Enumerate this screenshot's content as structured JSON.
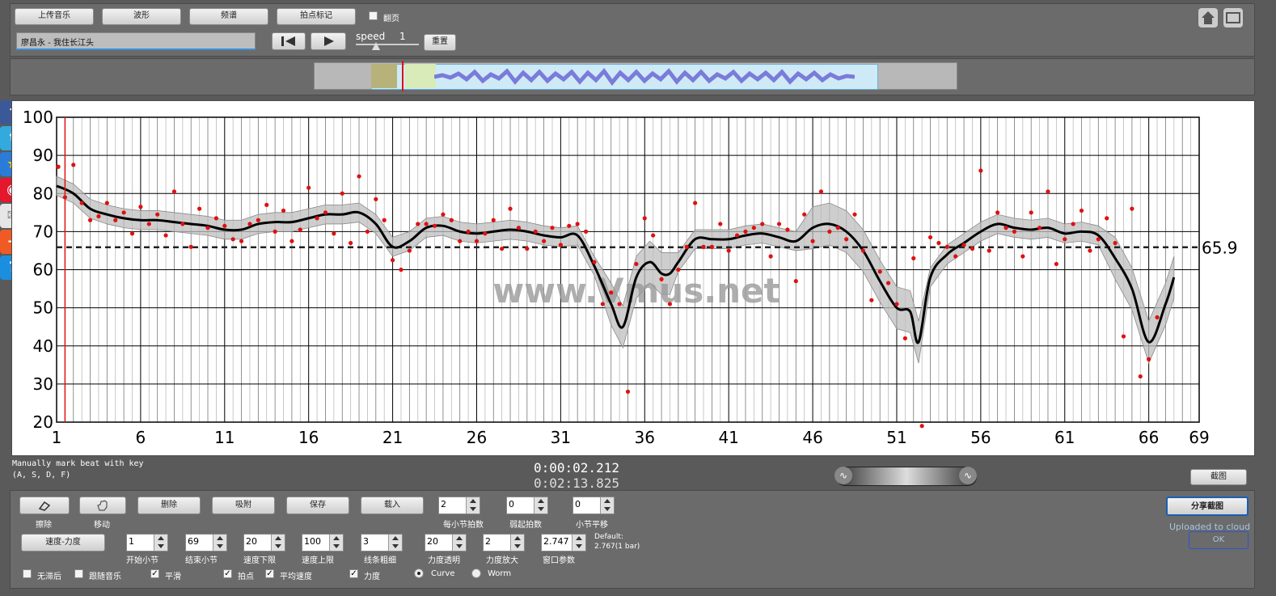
{
  "toolbar": {
    "upload": "上传音乐",
    "waveform": "波形",
    "spectrum": "频谱",
    "beat_mark": "拍点标记",
    "flip_label": "翻页"
  },
  "track": {
    "title": "廖昌永 - 我住长江头"
  },
  "speed": {
    "label": "speed",
    "value": "1",
    "reset": "重置"
  },
  "status": {
    "hint_line1": "Manually mark beat with key",
    "hint_line2": "(A, S, D, F)",
    "time_current": "0:00:02.212",
    "time_total": "0:02:13.825",
    "screenshot": "截图",
    "share": "分享截图",
    "uploaded": "Uploaded to cloud",
    "ok": "OK"
  },
  "controls": {
    "erase": "擦除",
    "move": "移动",
    "delete": "删除",
    "snap": "吸附",
    "save": "保存",
    "load": "载入",
    "beats_per_bar": {
      "value": "2",
      "label": "每小节拍数"
    },
    "weak_beats": {
      "value": "0",
      "label": "弱起拍数"
    },
    "bar_shift": {
      "value": "0",
      "label": "小节平移"
    },
    "mode_button": "速度-力度",
    "start_bar": {
      "value": "1",
      "label": "开始小节"
    },
    "end_bar": {
      "value": "69",
      "label": "结束小节"
    },
    "tempo_min": {
      "value": "20",
      "label": "速度下限"
    },
    "tempo_max": {
      "value": "100",
      "label": "速度上限"
    },
    "line_width": {
      "value": "3",
      "label": "线条粗细"
    },
    "force_alpha": {
      "value": "20",
      "label": "力度透明"
    },
    "force_scale": {
      "value": "2",
      "label": "力度放大"
    },
    "window": {
      "value": "2.747",
      "label": "窗口参数"
    },
    "default_line1": "Default:",
    "default_line2": "2.767(1 bar)",
    "checks": {
      "no_lag": "无滞后",
      "follow": "跟随音乐",
      "smooth": "平滑",
      "beats": "拍点",
      "avg": "平均速度",
      "force": "力度",
      "curve": "Curve",
      "worm": "Worm"
    }
  },
  "watermark": "www.Vmus.net",
  "chart_data": {
    "type": "line",
    "xlim": [
      1,
      69
    ],
    "ylim": [
      20,
      100
    ],
    "x_ticks": [
      1,
      6,
      11,
      16,
      21,
      26,
      31,
      36,
      41,
      46,
      51,
      56,
      61,
      66,
      69
    ],
    "y_ticks": [
      20,
      30,
      40,
      50,
      60,
      70,
      80,
      90,
      100
    ],
    "avg_label": "65.9",
    "avg_value": 65.9,
    "playhead_x": 1.5,
    "smooth": [
      [
        1,
        82
      ],
      [
        2,
        80
      ],
      [
        3,
        76
      ],
      [
        4,
        74.5
      ],
      [
        5,
        73.5
      ],
      [
        6,
        73
      ],
      [
        7,
        73
      ],
      [
        8,
        72.5
      ],
      [
        9,
        72
      ],
      [
        10,
        71.5
      ],
      [
        11,
        70.5
      ],
      [
        12,
        70.5
      ],
      [
        13,
        72
      ],
      [
        14,
        72.5
      ],
      [
        15,
        72.5
      ],
      [
        16,
        73.5
      ],
      [
        17,
        74.5
      ],
      [
        18,
        74.5
      ],
      [
        19,
        75
      ],
      [
        20,
        72
      ],
      [
        21,
        66
      ],
      [
        22,
        67.5
      ],
      [
        23,
        71
      ],
      [
        24,
        71.5
      ],
      [
        25,
        70
      ],
      [
        26,
        69.5
      ],
      [
        27,
        70
      ],
      [
        28,
        70.5
      ],
      [
        29,
        70
      ],
      [
        30,
        69
      ],
      [
        31,
        68.5
      ],
      [
        32,
        69
      ],
      [
        33,
        61
      ],
      [
        34,
        51
      ],
      [
        34.7,
        45
      ],
      [
        35.5,
        58
      ],
      [
        36.3,
        62
      ],
      [
        37,
        59
      ],
      [
        37.5,
        59
      ],
      [
        38,
        62
      ],
      [
        39,
        68
      ],
      [
        40,
        68
      ],
      [
        41,
        68
      ],
      [
        42,
        69
      ],
      [
        43,
        69.5
      ],
      [
        44,
        68.5
      ],
      [
        45,
        67.5
      ],
      [
        46,
        71
      ],
      [
        47,
        72
      ],
      [
        48,
        70
      ],
      [
        49,
        65
      ],
      [
        50,
        57
      ],
      [
        51,
        50
      ],
      [
        51.8,
        49
      ],
      [
        52.3,
        41
      ],
      [
        53,
        58
      ],
      [
        54,
        64
      ],
      [
        55,
        67
      ],
      [
        56,
        70
      ],
      [
        57,
        72
      ],
      [
        58,
        71
      ],
      [
        59,
        70.5
      ],
      [
        60,
        71
      ],
      [
        61,
        69.5
      ],
      [
        62,
        70
      ],
      [
        63,
        69
      ],
      [
        64,
        63
      ],
      [
        65,
        55
      ],
      [
        66,
        41
      ],
      [
        67,
        51
      ],
      [
        67.5,
        58
      ]
    ],
    "beats": [
      [
        1.1,
        87
      ],
      [
        1.5,
        79
      ],
      [
        2,
        87.5
      ],
      [
        2.5,
        77.5
      ],
      [
        3,
        73
      ],
      [
        3.5,
        74
      ],
      [
        4,
        77.5
      ],
      [
        4.5,
        73
      ],
      [
        5,
        75
      ],
      [
        5.5,
        69.5
      ],
      [
        6,
        76.5
      ],
      [
        6.5,
        72
      ],
      [
        7,
        74.5
      ],
      [
        7.5,
        69
      ],
      [
        8,
        80.5
      ],
      [
        8.5,
        72
      ],
      [
        9,
        66
      ],
      [
        9.5,
        76
      ],
      [
        10,
        71
      ],
      [
        10.5,
        73.5
      ],
      [
        11,
        71.5
      ],
      [
        11.5,
        68
      ],
      [
        12,
        67.5
      ],
      [
        12.5,
        72
      ],
      [
        13,
        73
      ],
      [
        13.5,
        77
      ],
      [
        14,
        70
      ],
      [
        14.5,
        75.5
      ],
      [
        15,
        67.5
      ],
      [
        15.5,
        70.5
      ],
      [
        16,
        81.5
      ],
      [
        16.5,
        73.5
      ],
      [
        17,
        75
      ],
      [
        17.5,
        69.5
      ],
      [
        18,
        80
      ],
      [
        18.5,
        67
      ],
      [
        19,
        84.5
      ],
      [
        19.5,
        70
      ],
      [
        20,
        78.5
      ],
      [
        20.5,
        73
      ],
      [
        21,
        62.5
      ],
      [
        21.5,
        60
      ],
      [
        22,
        65
      ],
      [
        22.5,
        72
      ],
      [
        23,
        72
      ],
      [
        23.5,
        71.5
      ],
      [
        24,
        74.5
      ],
      [
        24.5,
        73
      ],
      [
        25,
        67.5
      ],
      [
        25.5,
        70
      ],
      [
        26,
        67.5
      ],
      [
        26.5,
        69.5
      ],
      [
        27,
        73
      ],
      [
        27.5,
        65.5
      ],
      [
        28,
        76
      ],
      [
        28.5,
        71
      ],
      [
        29,
        65.5
      ],
      [
        29.5,
        70
      ],
      [
        30,
        67.5
      ],
      [
        30.5,
        71
      ],
      [
        31,
        66.5
      ],
      [
        31.5,
        71.5
      ],
      [
        32,
        72
      ],
      [
        32.5,
        70
      ],
      [
        33,
        62
      ],
      [
        33.5,
        51
      ],
      [
        34,
        54
      ],
      [
        34.5,
        51
      ],
      [
        35,
        28
      ],
      [
        35.5,
        61.5
      ],
      [
        36,
        73.5
      ],
      [
        36.5,
        69
      ],
      [
        37,
        57.5
      ],
      [
        37.5,
        51
      ],
      [
        38,
        60
      ],
      [
        38.5,
        66
      ],
      [
        39,
        77.5
      ],
      [
        39.5,
        66
      ],
      [
        40,
        66
      ],
      [
        40.5,
        72
      ],
      [
        41,
        65
      ],
      [
        41.5,
        69
      ],
      [
        42,
        70
      ],
      [
        42.5,
        71
      ],
      [
        43,
        72
      ],
      [
        43.5,
        63.5
      ],
      [
        44,
        72
      ],
      [
        44.5,
        70.5
      ],
      [
        45,
        57
      ],
      [
        45.5,
        74.5
      ],
      [
        46,
        67.5
      ],
      [
        46.5,
        80.5
      ],
      [
        47,
        70
      ],
      [
        47.5,
        71
      ],
      [
        48,
        68
      ],
      [
        48.5,
        74.5
      ],
      [
        49,
        65
      ],
      [
        49.5,
        52
      ],
      [
        50,
        59.5
      ],
      [
        50.5,
        56.5
      ],
      [
        51,
        51
      ],
      [
        51.5,
        42
      ],
      [
        52,
        63
      ],
      [
        52.5,
        19
      ],
      [
        53,
        68.5
      ],
      [
        53.5,
        67
      ],
      [
        54,
        66
      ],
      [
        54.5,
        63.5
      ],
      [
        55,
        66.5
      ],
      [
        55.5,
        65.5
      ],
      [
        56,
        86
      ],
      [
        56.5,
        65
      ],
      [
        57,
        75
      ],
      [
        57.5,
        71
      ],
      [
        58,
        70
      ],
      [
        58.5,
        63.5
      ],
      [
        59,
        75
      ],
      [
        59.5,
        71
      ],
      [
        60,
        80.5
      ],
      [
        60.5,
        61.5
      ],
      [
        61,
        68
      ],
      [
        61.5,
        72
      ],
      [
        62,
        75.5
      ],
      [
        62.5,
        65
      ],
      [
        63,
        68
      ],
      [
        63.5,
        73.5
      ],
      [
        64,
        67
      ],
      [
        64.5,
        42.5
      ],
      [
        65,
        76
      ],
      [
        65.5,
        32
      ],
      [
        66,
        36.5
      ],
      [
        66.5,
        47.5
      ]
    ]
  }
}
